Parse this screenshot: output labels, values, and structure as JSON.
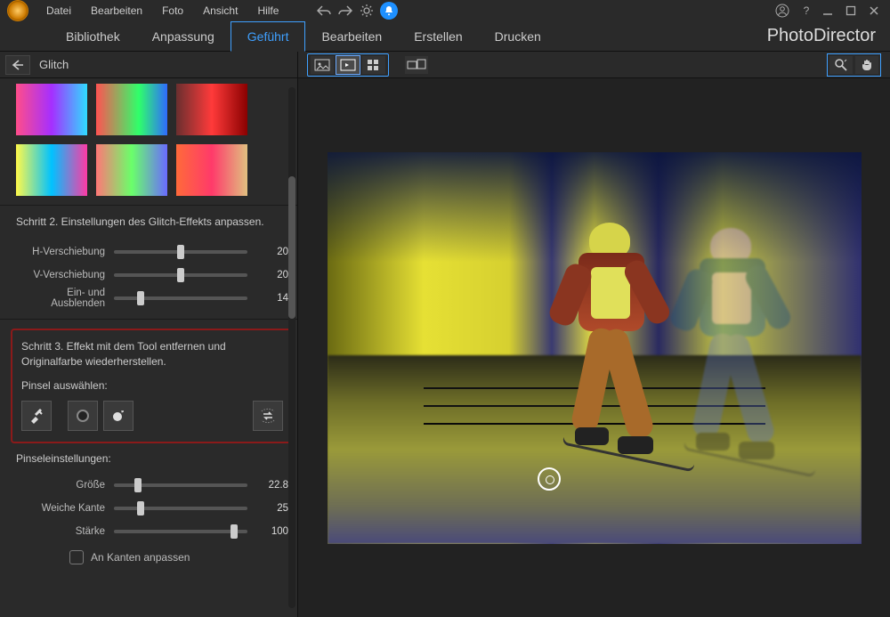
{
  "menubar": {
    "items": [
      "Datei",
      "Bearbeiten",
      "Foto",
      "Ansicht",
      "Hilfe"
    ]
  },
  "titlebar": {
    "icons": {
      "undo": "undo-icon",
      "redo": "redo-icon",
      "settings": "gear-icon",
      "notification": "bell-icon",
      "account": "user-icon",
      "help": "?"
    }
  },
  "tabs": {
    "items": [
      "Bibliothek",
      "Anpassung",
      "Geführt",
      "Bearbeiten",
      "Erstellen",
      "Drucken"
    ],
    "active_index": 2
  },
  "brand": "PhotoDirector",
  "left_panel": {
    "title": "Glitch",
    "thumbnails": [
      "r1c1",
      "r1c2",
      "r1c3",
      "r2c1",
      "r2c2",
      "r2c3"
    ],
    "step2": {
      "title": "Schritt 2. Einstellungen des Glitch-Effekts anpassen.",
      "sliders": [
        {
          "label": "H-Verschiebung",
          "value": 20,
          "pos": 50
        },
        {
          "label": "V-Verschiebung",
          "value": 20,
          "pos": 50
        },
        {
          "label": "Ein- und Ausblenden",
          "value": 14,
          "pos": 20
        }
      ]
    },
    "step3": {
      "title": "Schritt 3. Effekt mit dem Tool entfernen und Originalfarbe wiederherstellen.",
      "brush_label": "Pinsel auswählen:",
      "tools": [
        "restore-tool",
        "circle-brush",
        "smart-brush",
        "swap-tool"
      ]
    },
    "brush_settings": {
      "title": "Pinseleinstellungen:",
      "sliders": [
        {
          "label": "Größe",
          "value": 22.8,
          "pos": 18
        },
        {
          "label": "Weiche Kante",
          "value": 25,
          "pos": 20
        },
        {
          "label": "Stärke",
          "value": 100,
          "pos": 90
        }
      ],
      "edge_checkbox": "An Kanten anpassen"
    }
  },
  "viewer_toolbar": {
    "view_modes": [
      "single-image",
      "compare-image",
      "grid-view"
    ],
    "active_view": 1,
    "extra": "dual-monitor",
    "zoom": "zoom-icon",
    "pan": "hand-icon"
  }
}
